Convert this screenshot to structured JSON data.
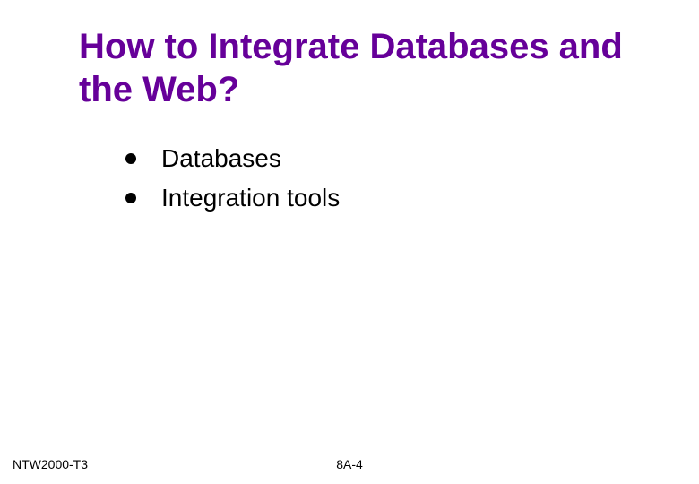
{
  "title": "How to Integrate Databases and the Web?",
  "bullets": {
    "b0": "Databases",
    "b1": "Integration tools"
  },
  "footer": {
    "left": "NTW2000-T3",
    "center": "8A-4"
  }
}
